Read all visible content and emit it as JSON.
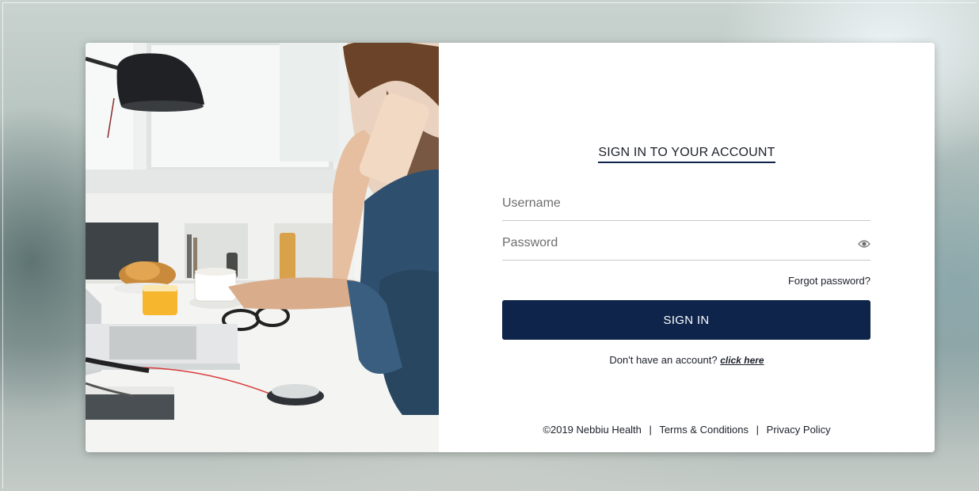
{
  "login": {
    "title": "SIGN IN TO YOUR ACCOUNT",
    "username_placeholder": "Username",
    "password_placeholder": "Password",
    "password_toggle_icon": "eye-icon",
    "forgot_password": "Forgot password?",
    "signin_label": "SIGN IN",
    "register_prompt": "Don't have an account?",
    "register_link": "click here"
  },
  "footer": {
    "copyright": "©2019 Nebbiu Health",
    "separator": "|",
    "terms": "Terms & Conditions",
    "privacy": "Privacy Policy"
  },
  "colors": {
    "primary": "#0e244b",
    "text": "#1b1f2a",
    "card": "#ffffff"
  }
}
